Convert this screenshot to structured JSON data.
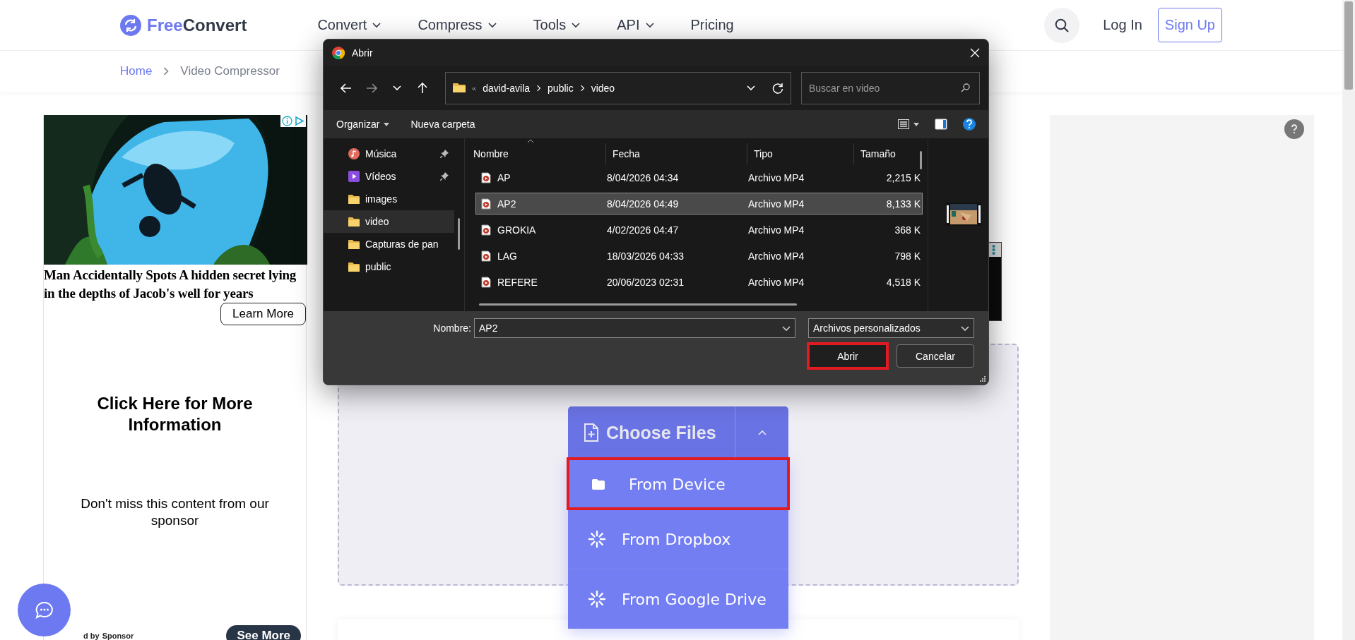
{
  "header": {
    "logo_first": "Free",
    "logo_second": "Convert",
    "nav": [
      {
        "label": "Convert",
        "dropdown": true
      },
      {
        "label": "Compress",
        "dropdown": true
      },
      {
        "label": "Tools",
        "dropdown": true
      },
      {
        "label": "API",
        "dropdown": true
      },
      {
        "label": "Pricing",
        "dropdown": false
      }
    ],
    "login": "Log In",
    "signup": "Sign Up"
  },
  "breadcrumb": [
    "Home",
    "Video Compressor"
  ],
  "left_ad": {
    "headline": "Man Accidentally Spots A hidden secret lying in the depths of Jacob's well for years",
    "learn_more": "Learn More",
    "title": "Click Here for More Information",
    "text": "Don't miss this content from our sponsor",
    "credit": "d by",
    "sponsor": "Sponsor",
    "see_more": "See More"
  },
  "uploader": {
    "button": "Choose Files",
    "expanded": true,
    "sources": [
      {
        "label": "From Device",
        "kind": "device",
        "highlighted": true
      },
      {
        "label": "From Dropbox",
        "kind": "cloud",
        "highlighted": false
      },
      {
        "label": "From Google Drive",
        "kind": "cloud",
        "highlighted": false
      }
    ]
  },
  "dialog": {
    "title": "Abrir",
    "path_overflow": "«",
    "path": [
      "david-avila",
      "public",
      "video"
    ],
    "search_placeholder": "Buscar en video",
    "toolbar": {
      "organize": "Organizar",
      "new_folder": "Nueva carpeta"
    },
    "sidebar": [
      {
        "label": "Música",
        "kind": "music",
        "pinned": true,
        "selected": false
      },
      {
        "label": "Vídeos",
        "kind": "videos",
        "pinned": true,
        "selected": false
      },
      {
        "label": "images",
        "kind": "folder",
        "pinned": false,
        "selected": false
      },
      {
        "label": "video",
        "kind": "folder",
        "pinned": false,
        "selected": true
      },
      {
        "label": "Capturas de pan",
        "kind": "folder",
        "pinned": false,
        "selected": false
      },
      {
        "label": "public",
        "kind": "folder",
        "pinned": false,
        "selected": false
      }
    ],
    "columns": [
      "Nombre",
      "Fecha",
      "Tipo",
      "Tamaño"
    ],
    "rows": [
      {
        "name": "AP",
        "date": "8/04/2026 04:34",
        "type": "Archivo MP4",
        "size": "2,215 K",
        "selected": false
      },
      {
        "name": "AP2",
        "date": "8/04/2026 04:49",
        "type": "Archivo MP4",
        "size": "8,133 K",
        "selected": true
      },
      {
        "name": "GROKIA",
        "date": "4/02/2026 04:47",
        "type": "Archivo MP4",
        "size": "368 K",
        "selected": false
      },
      {
        "name": "LAG",
        "date": "18/03/2026 04:33",
        "type": "Archivo MP4",
        "size": "798 K",
        "selected": false
      },
      {
        "name": "REFERE",
        "date": "20/06/2023 02:31",
        "type": "Archivo MP4",
        "size": "4,518 K",
        "selected": false
      }
    ],
    "filename_label": "Nombre:",
    "filename": "AP2",
    "filter": "Archivos personalizados",
    "open_button": {
      "label": "Abrir",
      "highlighted": true
    },
    "cancel_button": "Cancelar"
  }
}
